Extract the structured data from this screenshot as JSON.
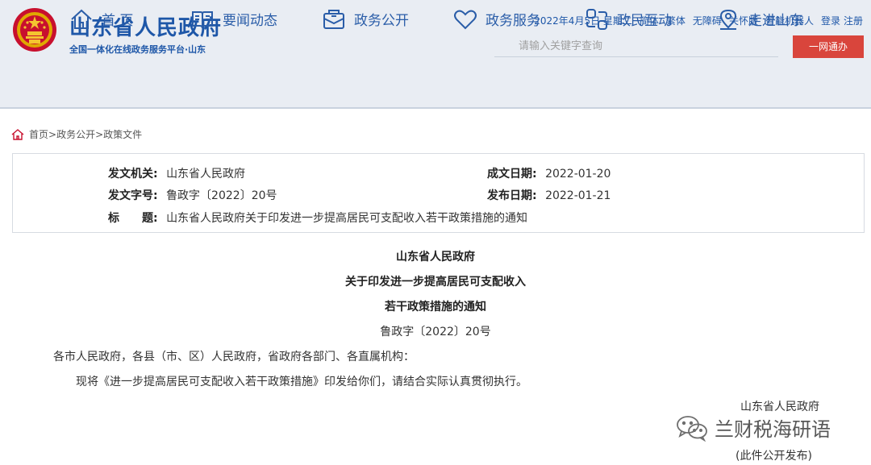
{
  "header": {
    "title": "山东省人民政府",
    "subtitle": "全国一体化在线政务服务平台·山东",
    "date": "2022年4月5日 星期二",
    "links": [
      "简体",
      "繁体",
      "无障碍",
      "关怀版",
      "智能机器人",
      "登录",
      "注册"
    ],
    "search_placeholder": "请输入关键字查询",
    "yiwang_label": "一网通办"
  },
  "nav": [
    {
      "label": "首 页",
      "icon": "home-icon"
    },
    {
      "label": "要闻动态",
      "icon": "book-icon"
    },
    {
      "label": "政务公开",
      "icon": "mailbox-icon"
    },
    {
      "label": "政务服务",
      "icon": "heart-icon"
    },
    {
      "label": "政民互动",
      "icon": "interact-icon"
    },
    {
      "label": "走进山东",
      "icon": "location-icon"
    }
  ],
  "breadcrumb": [
    "首页",
    "政务公开",
    "政策文件"
  ],
  "meta": {
    "issuer_label": "发文机关:",
    "issuer": "山东省人民政府",
    "doc_no_label": "发文字号:",
    "doc_no": "鲁政字〔2022〕20号",
    "title_label": "标　　题:",
    "title": "山东省人民政府关于印发进一步提高居民可支配收入若干政策措施的通知",
    "created_label": "成文日期:",
    "created": "2022-01-20",
    "published_label": "发布日期:",
    "published": "2022-01-21"
  },
  "document": {
    "title_lines": [
      "山东省人民政府",
      "关于印发进一步提高居民可支配收入",
      "若干政策措施的通知"
    ],
    "doc_no": "鲁政字〔2022〕20号",
    "recipients": "各市人民政府，各县（市、区）人民政府，省政府各部门、各直属机构：",
    "body": "现将《进一步提高居民可支配收入若干政策措施》印发给你们，请结合实际认真贯彻执行。",
    "signature": "山东省人民政府",
    "note": "(此件公开发布)"
  },
  "watermark": "兰财税海研语",
  "colors": {
    "brand": "#1e57a8",
    "accent": "#d9453c",
    "header_bg": "#e9edf3"
  }
}
